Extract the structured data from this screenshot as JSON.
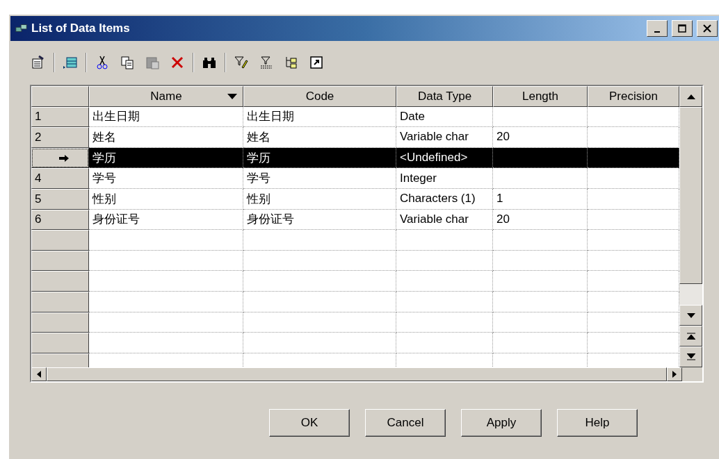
{
  "window": {
    "title": "List of Data Items"
  },
  "table": {
    "columns": [
      {
        "label": "Name",
        "sorted": true
      },
      {
        "label": "Code",
        "sorted": false
      },
      {
        "label": "Data Type",
        "sorted": false
      },
      {
        "label": "Length",
        "sorted": false
      },
      {
        "label": "Precision",
        "sorted": false
      }
    ],
    "rows": [
      {
        "number": "1",
        "selected": false,
        "cells": [
          "出生日期",
          "出生日期",
          "Date",
          "",
          ""
        ]
      },
      {
        "number": "2",
        "selected": false,
        "cells": [
          "姓名",
          "姓名",
          "Variable char",
          "20",
          ""
        ]
      },
      {
        "selected": true,
        "cells": [
          "学历",
          "学历",
          "<Undefined>",
          "",
          ""
        ]
      },
      {
        "number": "4",
        "selected": false,
        "cells": [
          "学号",
          "学号",
          "Integer",
          "",
          ""
        ]
      },
      {
        "number": "5",
        "selected": false,
        "cells": [
          "性别",
          "性别",
          "Characters (1)",
          "1",
          ""
        ]
      },
      {
        "number": "6",
        "selected": false,
        "cells": [
          "身份证号",
          "身份证号",
          "Variable char",
          "20",
          ""
        ]
      }
    ]
  },
  "buttons": [
    "OK",
    "Cancel",
    "Apply",
    "Help"
  ]
}
